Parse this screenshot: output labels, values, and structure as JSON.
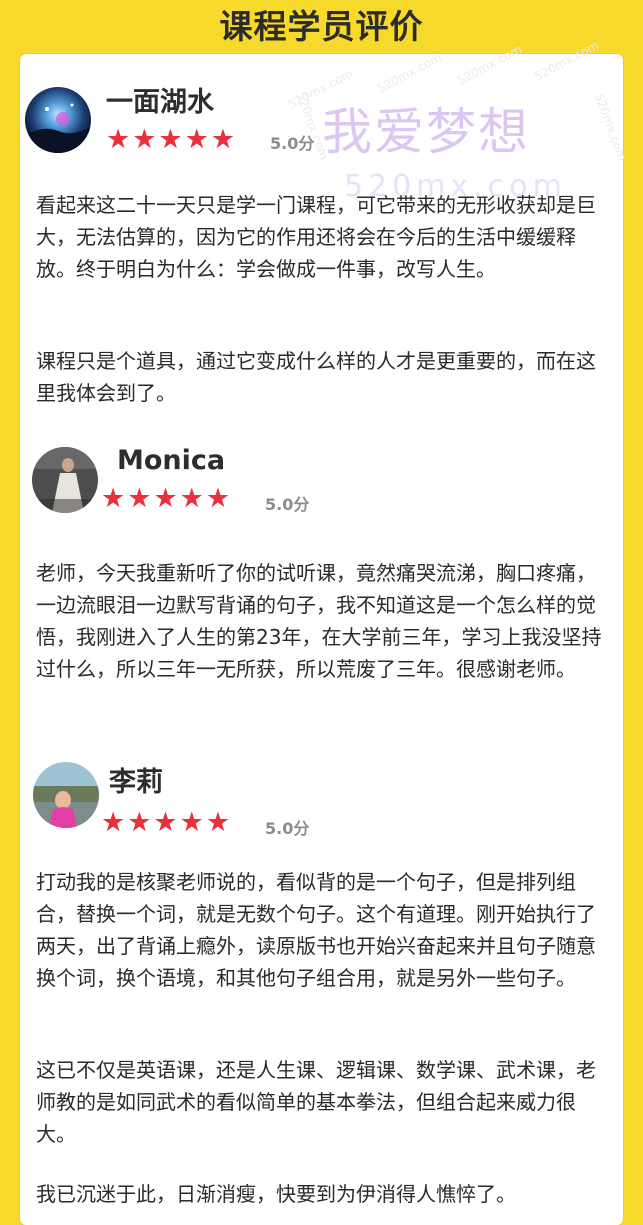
{
  "header": {
    "title": "课程学员评价"
  },
  "watermark": {
    "main": "我爱梦想",
    "url": "520mx.com",
    "small": "520mx.com"
  },
  "reviews": [
    {
      "name": "一面湖水",
      "stars": "★★★★★",
      "score": "5.0分",
      "paragraphs": [
        "看起来这二十一天只是学一门课程，可它带来的无形收获却是巨大，无法估算的，因为它的作用还将会在今后的生活中缓缓释放。终于明白为什么：学会做成一件事，改写人生。",
        "课程只是个道具，通过它变成什么样的人才是更重要的，而在这里我体会到了。"
      ]
    },
    {
      "name": "Monica",
      "stars": "★★★★★",
      "score": "5.0分",
      "paragraphs": [
        "老师，今天我重新听了你的试听课，竟然痛哭流涕，胸口疼痛，一边流眼泪一边默写背诵的句子，我不知道这是一个怎么样的觉悟，我刚进入了人生的第23年，在大学前三年，学习上我没坚持过什么，所以三年一无所获，所以荒废了三年。很感谢老师。"
      ]
    },
    {
      "name": "李莉",
      "stars": "★★★★★",
      "score": "5.0分",
      "paragraphs": [
        "打动我的是核聚老师说的，看似背的是一个句子，但是排列组合，替换一个词，就是无数个句子。这个有道理。刚开始执行了两天，出了背诵上瘾外，读原版书也开始兴奋起来并且句子随意换个词，换个语境，和其他句子组合用，就是另外一些句子。",
        "这已不仅是英语课，还是人生课、逻辑课、数学课、武术课，老师教的是如同武术的看似简单的基本拳法，但组合起来威力很大。",
        "我已沉迷于此，日渐消瘦，快要到为伊消得人憔悴了。"
      ]
    }
  ]
}
